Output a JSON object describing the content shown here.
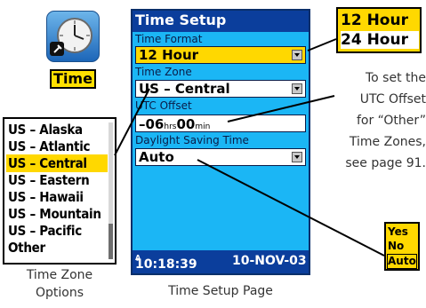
{
  "app_icon": {
    "label": "Time"
  },
  "zone_list": {
    "items": [
      "US – Alaska",
      "US – Atlantic",
      "US – Central",
      "US – Eastern",
      "US – Hawaii",
      "US – Mountain",
      "US – Pacific",
      "Other"
    ],
    "selected_index": 2,
    "caption_line1": "Time Zone",
    "caption_line2": "Options"
  },
  "screen": {
    "title": "Time Setup",
    "time_format_label": "Time Format",
    "time_format_value": "12 Hour",
    "time_zone_label": "Time Zone",
    "time_zone_value": "US – Central",
    "utc_offset_label": "UTC Offset",
    "utc_offset_hours": "–06",
    "utc_offset_hours_unit": "hrs",
    "utc_offset_minutes": "00",
    "utc_offset_minutes_unit": "min",
    "dst_label": "Daylight Saving Time",
    "dst_value": "Auto",
    "status_time": "10:18:39",
    "status_ampm": "A",
    "status_date": "10-NOV-03",
    "caption": "Time Setup Page"
  },
  "hour_options": [
    "12 Hour",
    "24 Hour"
  ],
  "note": {
    "line1": "To set the",
    "line2": "UTC Offset",
    "line3": "for “Other”",
    "line4": "Time Zones,",
    "line5": "see page 91."
  },
  "dst_options": [
    "Yes",
    "No",
    "Auto"
  ],
  "colors": {
    "screen_bg": "#1bb6f5",
    "title_bar": "#0b3e9c",
    "highlight": "#ffd800"
  },
  "icons": {
    "app": "clock-icon",
    "dropdown": "dropdown-arrow-icon"
  }
}
